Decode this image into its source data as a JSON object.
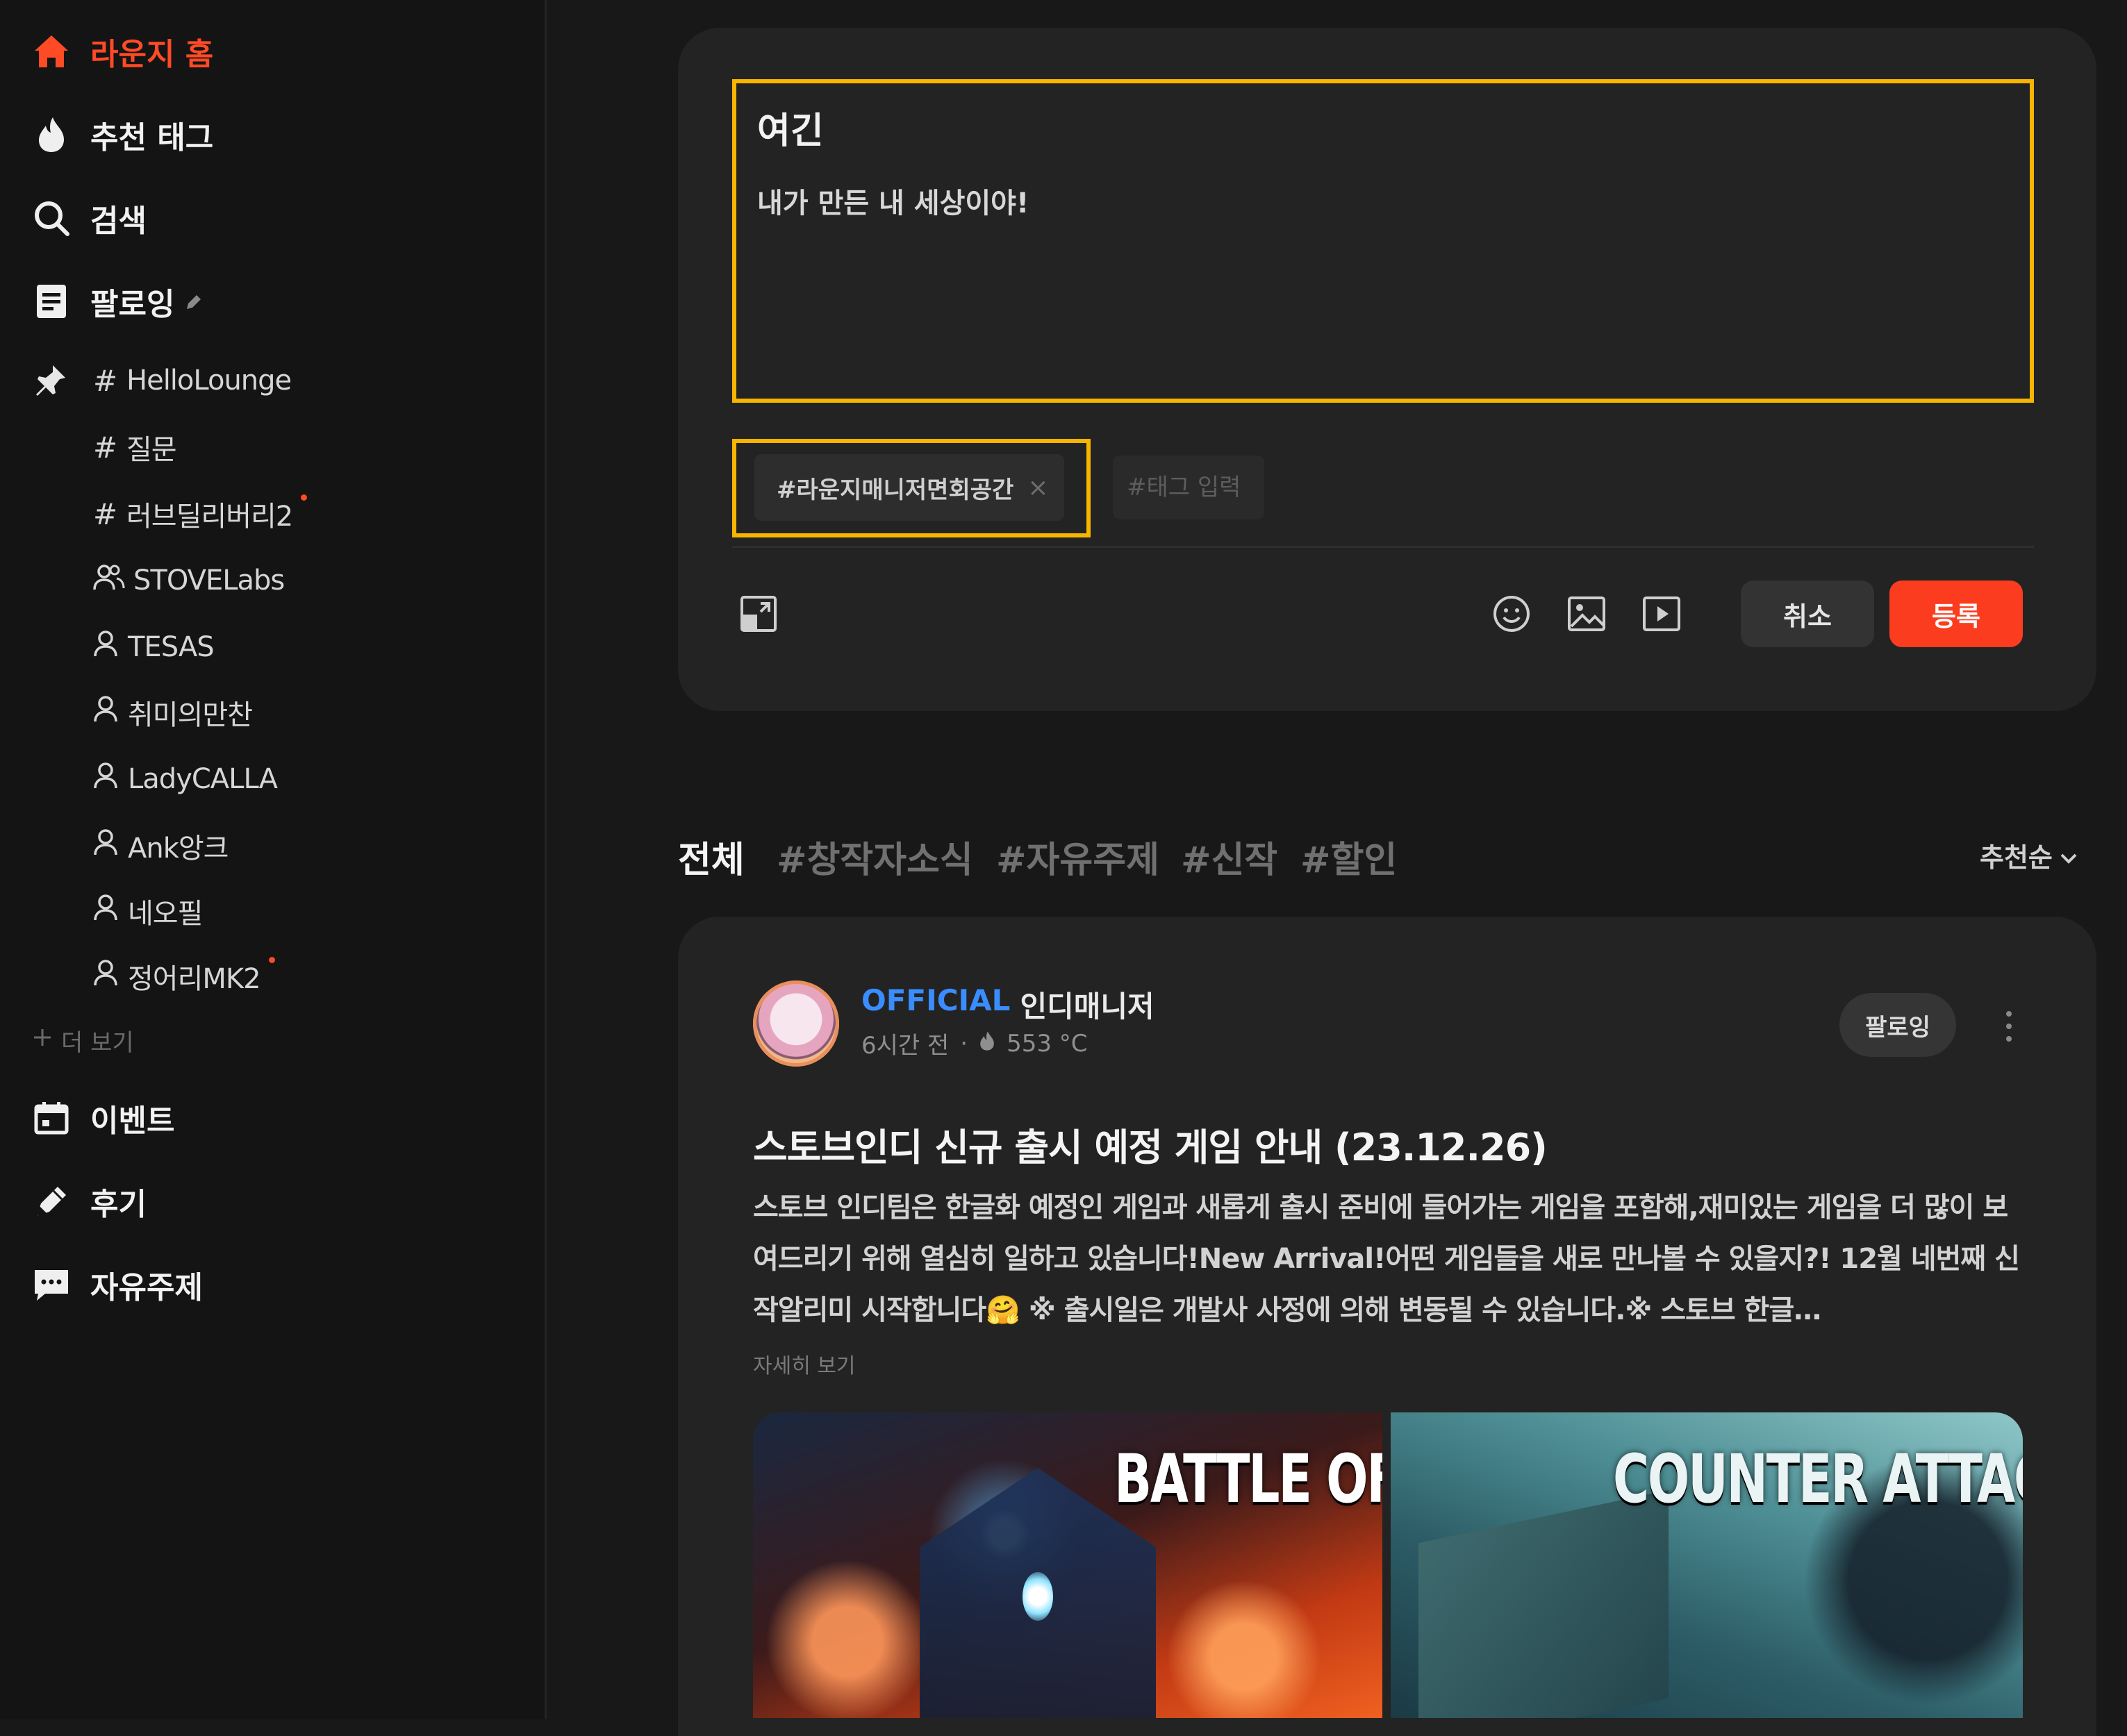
{
  "sidebar": {
    "main_nav": [
      {
        "label": "라운지 홈",
        "icon": "home-icon"
      },
      {
        "label": "추천 태그",
        "icon": "flame-icon"
      },
      {
        "label": "검색",
        "icon": "search-icon"
      },
      {
        "label": "팔로잉",
        "icon": "document-icon"
      }
    ],
    "following": [
      {
        "prefix": "#",
        "label": "HelloLounge",
        "pinned": true
      },
      {
        "prefix": "#",
        "label": "질문"
      },
      {
        "prefix": "#",
        "label": "러브딜리버리2",
        "new": true
      },
      {
        "prefix": "group",
        "label": "STOVELabs"
      },
      {
        "prefix": "user",
        "label": "TESAS"
      },
      {
        "prefix": "user",
        "label": "취미의만찬"
      },
      {
        "prefix": "user",
        "label": "LadyCALLA"
      },
      {
        "prefix": "user",
        "label": "Ank앙크"
      },
      {
        "prefix": "user",
        "label": "네오필"
      },
      {
        "prefix": "user",
        "label": "정어리MK2",
        "new": true
      }
    ],
    "more_label": "더 보기",
    "bottom_nav": [
      {
        "label": "이벤트",
        "icon": "calendar-icon"
      },
      {
        "label": "후기",
        "icon": "pen-icon"
      },
      {
        "label": "자유주제",
        "icon": "chat-icon"
      }
    ]
  },
  "composer": {
    "title": "여긴",
    "body": "내가 만든 내 세상이야!",
    "tag_chip": "#라운지매니저면회공간",
    "tag_input_placeholder": "#태그 입력",
    "cancel_label": "취소",
    "submit_label": "등록"
  },
  "filters": {
    "tabs": [
      "전체",
      "#창작자소식",
      "#자유주제",
      "#신작",
      "#할인"
    ],
    "active": "전체",
    "sort_label": "추천순"
  },
  "post": {
    "official_badge": "OFFICIAL",
    "author": "인디매니저",
    "time": "6시간 전",
    "temperature": "553 °C",
    "follow_label": "팔로잉",
    "title": "스토브인디 신규 출시 예정 게임 안내 (23.12.26)",
    "body": "스토브 인디팀은 한글화 예정인 게임과 새롭게 출시 준비에 들어가는 게임을 포함해,재미있는 게임을 더 많이 보여드리기 위해 열심히 일하고 있습니다!New Arrival!어떤 게임들을 새로 만나볼 수 있을지?! 12월 네번째 신작알리미 시작합니다🤗 ※ 출시일은 개발사 사정에 의해 변동될 수 있습니다.※ 스토브 한글…",
    "read_more": "자세히 보기",
    "thumbnails": [
      {
        "label": "BATTLE OF FAT"
      },
      {
        "label": "COUNTER ATTACI"
      }
    ]
  },
  "colors": {
    "accent": "#fc3c1f",
    "highlight": "#f7b500",
    "official": "#3a8dff"
  }
}
